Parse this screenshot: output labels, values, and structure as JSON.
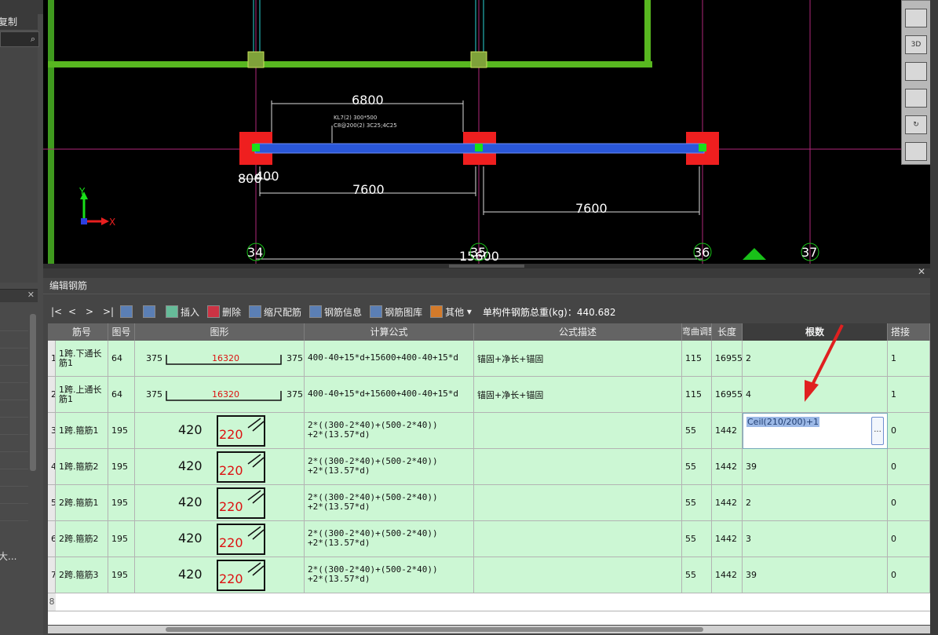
{
  "left_panel": {
    "tab_label": "复制",
    "bottom_label": "大..."
  },
  "cad": {
    "dimensions": {
      "top_span": "6800",
      "left_small_a": "800",
      "left_small_b": "400",
      "span_left": "7600",
      "span_right": "7600",
      "total": "15600"
    },
    "axis_labels": [
      "34",
      "35",
      "36",
      "37"
    ],
    "annotation_line1": "KL7(2) 300*500",
    "annotation_line2": "C8@200(2) 3C25;4C25",
    "axis_y": "Y",
    "axis_x": "X",
    "view_buttons": [
      "",
      "3D",
      "",
      "",
      "",
      ""
    ]
  },
  "rebar_panel": {
    "title": "编辑钢筋",
    "toolbar": {
      "first": "|<",
      "prev": "<",
      "next": ">",
      "last": ">|",
      "insert": "插入",
      "delete": "删除",
      "scale": "缩尺配筋",
      "info": "钢筋信息",
      "library": "钢筋图库",
      "other": "其他",
      "total_label": "单构件钢筋总重(kg)：440.682"
    },
    "columns": [
      "筋号",
      "图号",
      "图形",
      "计算公式",
      "公式描述",
      "弯曲调整",
      "长度",
      "根数",
      "搭接"
    ],
    "rows": [
      {
        "num": "1",
        "name": "1跨.下通长筋1",
        "fig": "64",
        "left": "375",
        "mid": "16320",
        "right": "375",
        "formula": "400-40+15*d+15600+400-40+15*d",
        "formula2": "",
        "desc": "锚固+净长+锚固",
        "bend": "115",
        "length": "16955",
        "count": "2",
        "lap": "1"
      },
      {
        "num": "2",
        "name": "1跨.上通长筋1",
        "fig": "64",
        "left": "375",
        "mid": "16320",
        "right": "375",
        "formula": "400-40+15*d+15600+400-40+15*d",
        "formula2": "",
        "desc": "锚固+净长+锚固",
        "bend": "115",
        "length": "16955",
        "count": "4",
        "lap": "1"
      },
      {
        "num": "3",
        "name": "1跨.箍筋1",
        "fig": "195",
        "left": "420",
        "mid": "220",
        "right": "",
        "formula": "2*((300-2*40)+(500-2*40))",
        "formula2": "+2*(13.57*d)",
        "desc": "",
        "bend": "55",
        "length": "1442",
        "count": "Ceil(210/200)+1",
        "lap": "0"
      },
      {
        "num": "4",
        "name": "1跨.箍筋2",
        "fig": "195",
        "left": "420",
        "mid": "220",
        "right": "",
        "formula": "2*((300-2*40)+(500-2*40))",
        "formula2": "+2*(13.57*d)",
        "desc": "",
        "bend": "55",
        "length": "1442",
        "count": "39",
        "lap": "0"
      },
      {
        "num": "5",
        "name": "2跨.箍筋1",
        "fig": "195",
        "left": "420",
        "mid": "220",
        "right": "",
        "formula": "2*((300-2*40)+(500-2*40))",
        "formula2": "+2*(13.57*d)",
        "desc": "",
        "bend": "55",
        "length": "1442",
        "count": "2",
        "lap": "0"
      },
      {
        "num": "6",
        "name": "2跨.箍筋2",
        "fig": "195",
        "left": "420",
        "mid": "220",
        "right": "",
        "formula": "2*((300-2*40)+(500-2*40))",
        "formula2": "+2*(13.57*d)",
        "desc": "",
        "bend": "55",
        "length": "1442",
        "count": "3",
        "lap": "0"
      },
      {
        "num": "7",
        "name": "2跨.箍筋3",
        "fig": "195",
        "left": "420",
        "mid": "220",
        "right": "",
        "formula": "2*((300-2*40)+(500-2*40))",
        "formula2": "+2*(13.57*d)",
        "desc": "",
        "bend": "55",
        "length": "1442",
        "count": "39",
        "lap": "0"
      }
    ],
    "empty_row_num": "8",
    "editing_value": "Ceil(210/200)+1",
    "edit_button": "..."
  }
}
